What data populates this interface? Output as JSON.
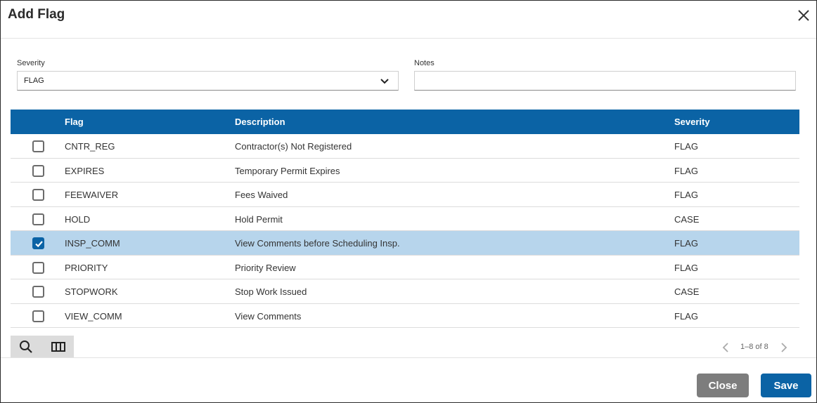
{
  "dialog": {
    "title": "Add Flag",
    "close_icon": "close-icon"
  },
  "form": {
    "severity_label": "Severity",
    "severity_value": "FLAG",
    "notes_label": "Notes",
    "notes_value": "",
    "notes_placeholder": ""
  },
  "table": {
    "headers": {
      "flag": "Flag",
      "description": "Description",
      "severity": "Severity"
    },
    "rows": [
      {
        "checked": false,
        "flag": "CNTR_REG",
        "description": "Contractor(s) Not Registered",
        "severity": "FLAG"
      },
      {
        "checked": false,
        "flag": "EXPIRES",
        "description": "Temporary Permit Expires",
        "severity": "FLAG"
      },
      {
        "checked": false,
        "flag": "FEEWAIVER",
        "description": "Fees Waived",
        "severity": "FLAG"
      },
      {
        "checked": false,
        "flag": "HOLD",
        "description": "Hold Permit",
        "severity": "CASE"
      },
      {
        "checked": true,
        "flag": "INSP_COMM",
        "description": "View Comments before Scheduling Insp.",
        "severity": "FLAG"
      },
      {
        "checked": false,
        "flag": "PRIORITY",
        "description": "Priority Review",
        "severity": "FLAG"
      },
      {
        "checked": false,
        "flag": "STOPWORK",
        "description": "Stop Work Issued",
        "severity": "CASE"
      },
      {
        "checked": false,
        "flag": "VIEW_COMM",
        "description": "View Comments",
        "severity": "FLAG"
      }
    ]
  },
  "toolbar": {
    "search_icon": "search-icon",
    "columns_icon": "columns-icon"
  },
  "pagination": {
    "text": "1–8 of 8"
  },
  "footer": {
    "close_label": "Close",
    "save_label": "Save"
  },
  "colors": {
    "header_bg": "#0b63a5",
    "selected_row_bg": "#b7d5ec",
    "close_button_bg": "#7d7d7d",
    "save_button_bg": "#0b63a5"
  }
}
